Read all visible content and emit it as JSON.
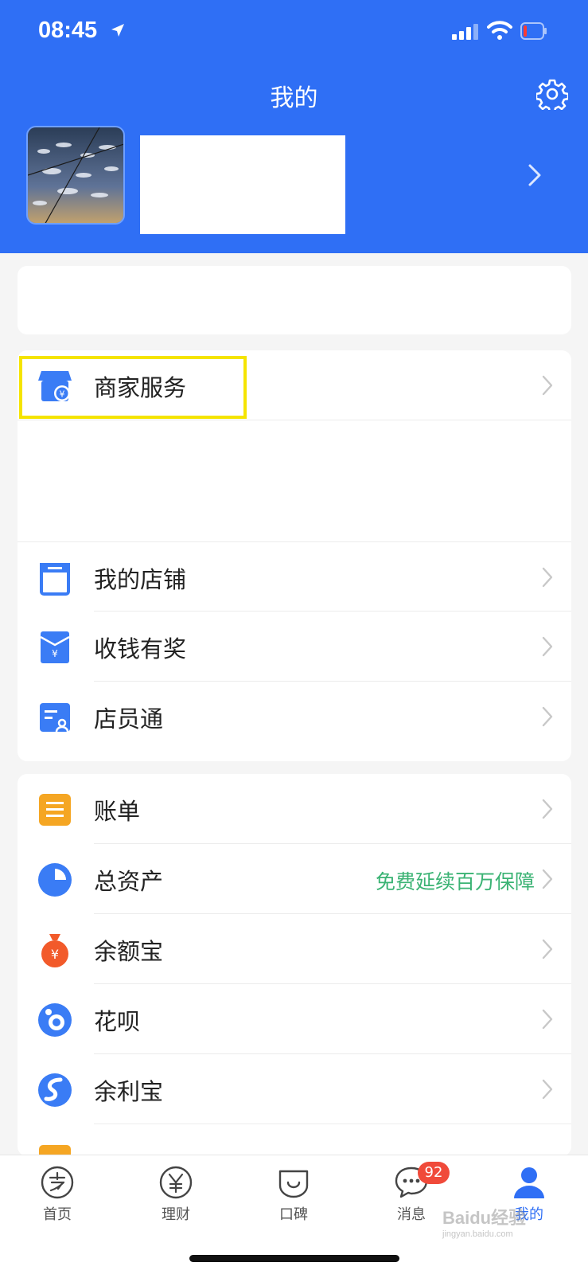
{
  "status": {
    "time": "08:45"
  },
  "header": {
    "title": "我的"
  },
  "card2": {
    "merchant": {
      "label": "商家服务"
    },
    "items": [
      {
        "label": "我的店铺"
      },
      {
        "label": "收钱有奖"
      },
      {
        "label": "店员通"
      }
    ]
  },
  "card3": {
    "items": [
      {
        "label": "账单"
      },
      {
        "label": "总资产",
        "sub": "免费延续百万保障"
      },
      {
        "label": "余额宝"
      },
      {
        "label": "花呗"
      },
      {
        "label": "余利宝"
      }
    ]
  },
  "tabs": [
    {
      "label": "首页"
    },
    {
      "label": "理财"
    },
    {
      "label": "口碑"
    },
    {
      "label": "消息",
      "badge": "92"
    },
    {
      "label": "我的"
    }
  ],
  "watermark": {
    "main": "Baidu经验",
    "sub": "jingyan.baidu.com"
  },
  "colors": {
    "brand": "#2f6ff5",
    "highlight": "#f5e400",
    "badge": "#f04a3a",
    "promo": "#3bb374"
  },
  "icons": [
    "location-arrow-icon",
    "signal-icon",
    "wifi-icon",
    "battery-icon",
    "gear-icon",
    "chevron-right-icon",
    "store-yen-icon",
    "store-icon",
    "red-packet-icon",
    "staff-card-icon",
    "bill-icon",
    "pie-chart-icon",
    "money-bag-icon",
    "huabei-icon",
    "yulibao-icon",
    "alipay-home-icon",
    "yen-coin-icon",
    "koubei-icon",
    "chat-bubble-icon",
    "user-icon"
  ]
}
